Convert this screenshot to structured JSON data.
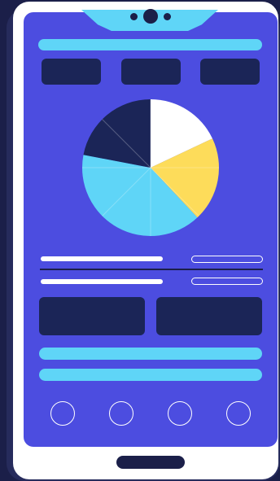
{
  "colors": {
    "background": "#1b1f49",
    "phone_body": "#ffffff",
    "screen": "#4c4de0",
    "accent_cyan": "#5fd5f7",
    "block_navy": "#1b2557",
    "pie_navy": "#1b2557",
    "pie_white": "#ffffff",
    "pie_yellow": "#fddc5a",
    "pie_cyan": "#5fd5f7"
  },
  "pie": {
    "slices": [
      {
        "name": "white",
        "fraction": 0.18,
        "color": "#ffffff"
      },
      {
        "name": "yellow",
        "fraction": 0.2,
        "color": "#fddc5a"
      },
      {
        "name": "cyan",
        "fraction": 0.4,
        "color": "#5fd5f7"
      },
      {
        "name": "navy",
        "fraction": 0.22,
        "color": "#1b2557"
      }
    ]
  },
  "nav": {
    "items": [
      {
        "icon": "circle-icon"
      },
      {
        "icon": "circle-icon"
      },
      {
        "icon": "circle-icon"
      },
      {
        "icon": "circle-icon"
      }
    ]
  }
}
